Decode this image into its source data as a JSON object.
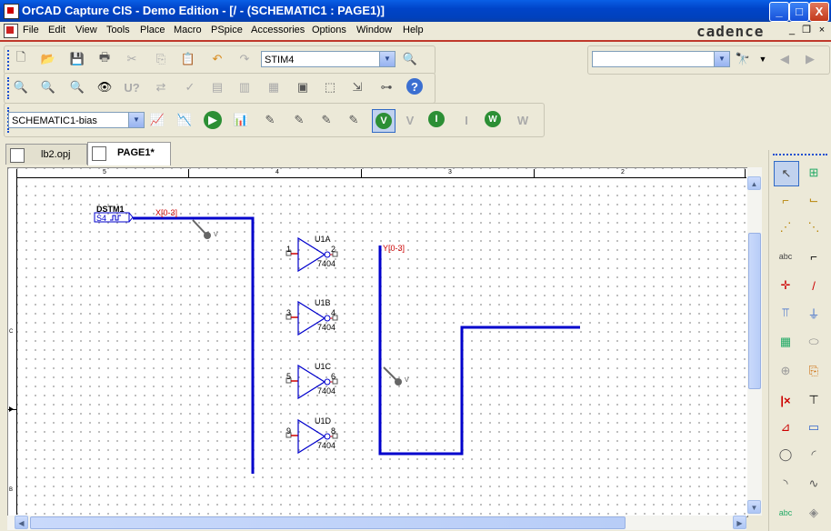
{
  "window": {
    "title": "OrCAD Capture CIS - Demo Edition - [/ - (SCHEMATIC1 : PAGE1)]",
    "controls": {
      "minimize": "_",
      "maximize": "□",
      "close": "X"
    }
  },
  "menubar": {
    "items": [
      "File",
      "Edit",
      "View",
      "Tools",
      "Place",
      "Macro",
      "PSpice",
      "Accessories",
      "Options",
      "Window",
      "Help"
    ],
    "logo": "cadence",
    "mdi_controls": {
      "minimize": "_",
      "restore": "❐",
      "close": "×"
    }
  },
  "toolbar1": {
    "part_combo": "STIM4",
    "find_combo": ""
  },
  "toolbar3": {
    "profile_combo": "SCHEMATIC1-bias"
  },
  "tabs": [
    {
      "label": "lb2.opj",
      "active": false
    },
    {
      "label": "PAGE1*",
      "active": true
    }
  ],
  "rulers": {
    "top": [
      "5",
      "4",
      "3",
      "2"
    ],
    "left": [
      "C",
      "B"
    ]
  },
  "schematic": {
    "stimulus": {
      "ref": "DSTM1",
      "value": "S4",
      "net": "X[0-3]"
    },
    "bus_y": "Y[0-3]",
    "probe_label": "V",
    "inverters": [
      {
        "ref": "U1A",
        "in": "1",
        "out": "2",
        "part": "7404"
      },
      {
        "ref": "U1B",
        "in": "3",
        "out": "4",
        "part": "7404"
      },
      {
        "ref": "U1C",
        "in": "5",
        "out": "6",
        "part": "7404"
      },
      {
        "ref": "U1D",
        "in": "9",
        "out": "8",
        "part": "7404"
      }
    ]
  },
  "colors": {
    "titlebar": "#0a5fe6",
    "wire": "#0000cc",
    "net_label": "#cc0000",
    "menu_rule": "#c0392b"
  }
}
